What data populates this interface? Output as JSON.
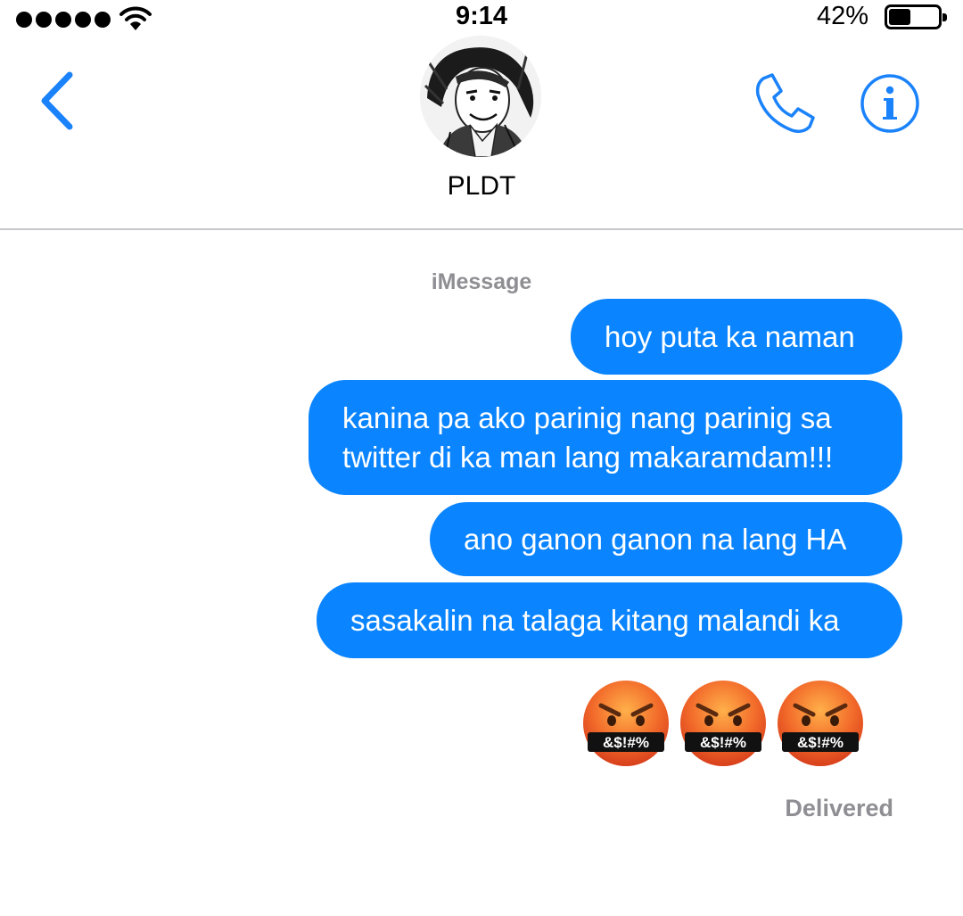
{
  "status_bar": {
    "time": "9:14",
    "battery_percent_label": "42%",
    "battery_level": 0.42,
    "signal_bars": 5,
    "wifi_icon": "wifi-icon"
  },
  "header": {
    "back_icon": "chevron-left-icon",
    "contact_name": "PLDT",
    "call_icon": "phone-icon",
    "info_icon": "info-icon",
    "accent_color": "#1a82fb"
  },
  "conversation": {
    "service_label": "iMessage",
    "messages": [
      {
        "text": "hoy puta ka naman",
        "sender": "me"
      },
      {
        "text": "kanina pa ako parinig nang parinig sa\ntwitter di ka man lang makaramdam!!!",
        "sender": "me"
      },
      {
        "text": "ano ganon ganon na lang HA",
        "sender": "me"
      },
      {
        "text": "sasakalin na talaga kitang malandi ka",
        "sender": "me"
      }
    ],
    "emoji_message": {
      "emoji_name": "face-with-symbols-on-mouth",
      "count": 3,
      "symbols": "&$!#%"
    },
    "status": "Delivered",
    "bubble_color": "#0a84ff"
  }
}
